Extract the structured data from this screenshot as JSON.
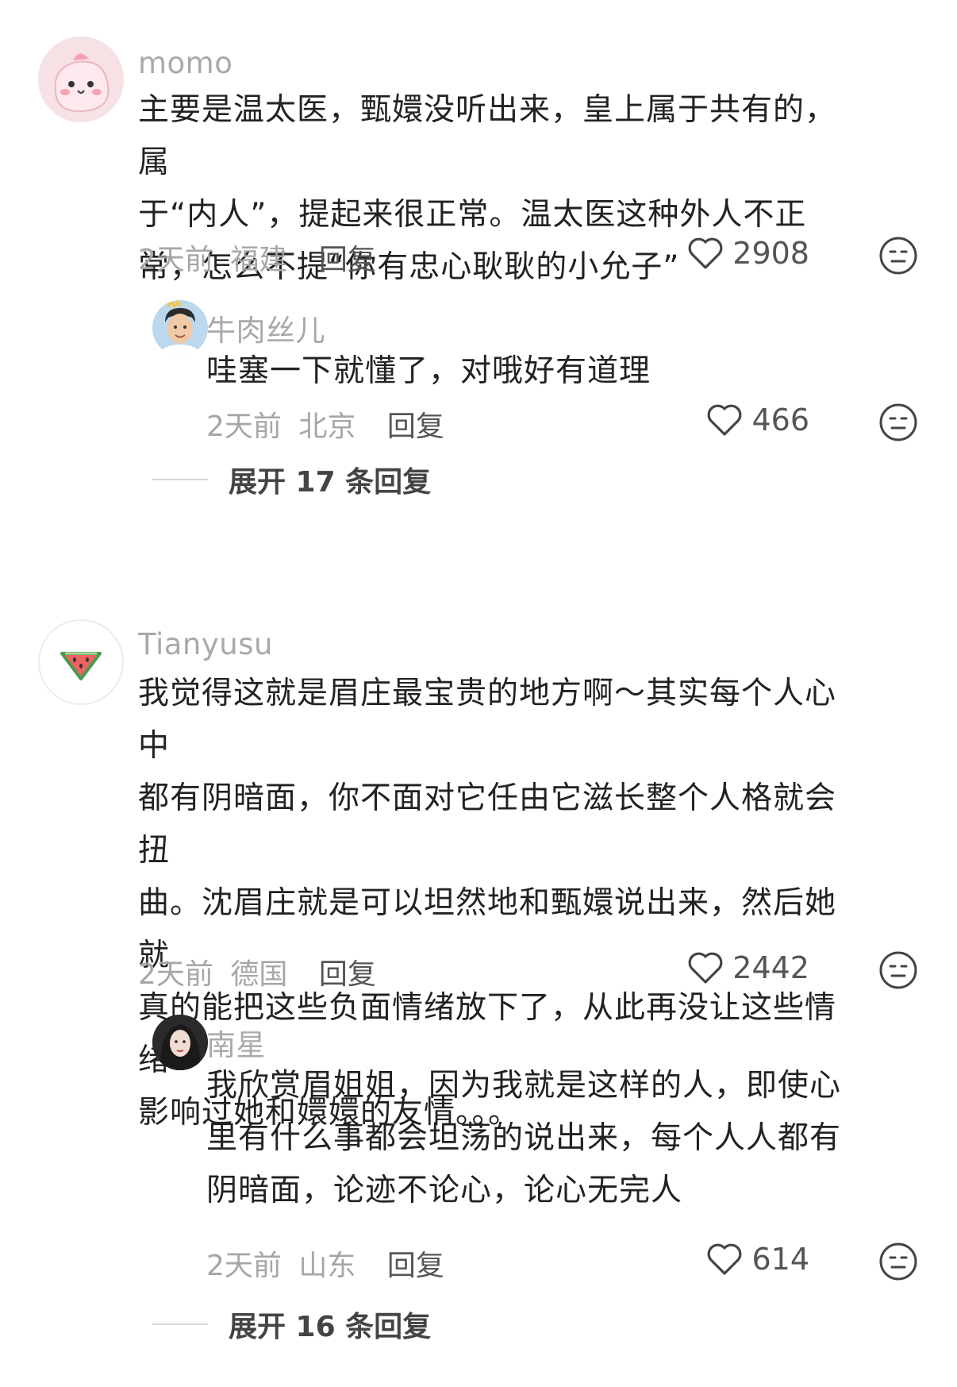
{
  "comments": [
    {
      "username": "momo",
      "avatar": "pink-blob-avatar",
      "text_lines": [
        "主要是温太医，甄嬛没听出来，皇上属于共有的，属",
        "于“内人”，提起来很正常。温太医这种外人不正",
        "常，怎么不提“你有忠心耿耿的小允子”"
      ],
      "time": "2天前",
      "location": "福建",
      "reply_label": "回复",
      "likes": "2908",
      "reply": {
        "username": "牛肉丝儿",
        "avatar": "man-photo-avatar",
        "text_lines": [
          "哇塞一下就懂了，对哦好有道理"
        ],
        "time": "2天前",
        "location": "北京",
        "reply_label": "回复",
        "likes": "466"
      },
      "expand_label": "展开 17 条回复"
    },
    {
      "username": "Tianyusu",
      "avatar": "watermelon-avatar",
      "text_lines": [
        "我觉得这就是眉庄最宝贵的地方啊～其实每个人心中",
        "都有阴暗面，你不面对它任由它滋长整个人格就会扭",
        "曲。沈眉庄就是可以坦然地和甄嬛说出来，然后她就",
        "真的能把这些负面情绪放下了，从此再没让这些情绪",
        "影响过她和嬛嬛的友情。。。"
      ],
      "time": "2天前",
      "location": "德国",
      "reply_label": "回复",
      "likes": "2442",
      "reply": {
        "username": "南星",
        "avatar": "woman-photo-avatar",
        "text_lines": [
          "我欣赏眉姐姐，因为我就是这样的人，即使心",
          "里有什么事都会坦荡的说出来，每个人人都有",
          "阴暗面，论迹不论心，论心无完人"
        ],
        "time": "2天前",
        "location": "山东",
        "reply_label": "回复",
        "likes": "614"
      },
      "expand_label": "展开 16 条回复"
    }
  ],
  "icons": {
    "like": "heart-outline-icon",
    "dislike": "neutral-face-icon"
  },
  "colors": {
    "text": "#222222",
    "meta": "#a6a6a6",
    "username": "#a9a9a9"
  }
}
